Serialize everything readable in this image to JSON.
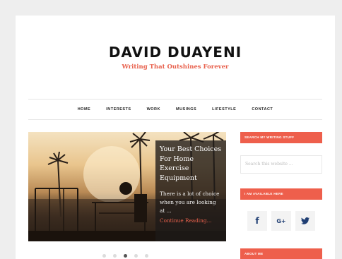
{
  "site": {
    "title": "DAVID DUAYENI",
    "tagline": "Writing That Outshines Forever"
  },
  "nav": {
    "items": [
      "HOME",
      "INTERESTS",
      "WORK",
      "MUSINGS",
      "LIFESTYLE",
      "CONTACT"
    ]
  },
  "slider": {
    "title": "Your Best Choices For Home Exercise Equipment",
    "excerpt": "There is a lot of choice when you are looking at ...",
    "link": "Continue Reading...",
    "dot_count": 5,
    "active_dot": 2
  },
  "sidebar": {
    "search_heading": "SEARCH MY WRITING STUFF",
    "search_placeholder": "Search this website ...",
    "social_heading": "I AM AVAILABLE HERE",
    "about_heading": "ABOUT ME",
    "social": [
      {
        "icon": "facebook-icon",
        "glyph": "f"
      },
      {
        "icon": "google-plus-icon",
        "glyph": "G+"
      },
      {
        "icon": "twitter-icon",
        "glyph": "🐦"
      }
    ]
  },
  "colors": {
    "accent": "#ee5f4c",
    "tagline": "#e8604c",
    "social_icon": "#1f3e73"
  }
}
